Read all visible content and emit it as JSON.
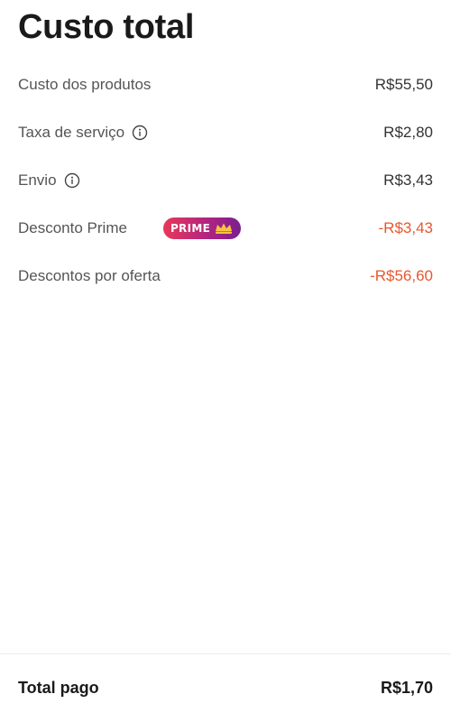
{
  "header": {
    "title": "Custo total"
  },
  "rows": [
    {
      "label": "Custo dos produtos",
      "value": "R$55,50"
    },
    {
      "label": "Taxa de serviço",
      "value": "R$2,80"
    },
    {
      "label": "Envio",
      "value": "R$3,43"
    },
    {
      "label": "Desconto Prime",
      "badge": "PRIME",
      "value": "-R$3,43"
    },
    {
      "label": "Descontos por oferta",
      "value": "-R$56,60"
    }
  ],
  "footer": {
    "label": "Total pago",
    "value": "R$1,70"
  },
  "colors": {
    "discount": "#e8572f",
    "prime_gradient_start": "#e8385a",
    "prime_gradient_end": "#7a1f8e",
    "crown": "#f6c343"
  },
  "icons": {
    "service_fee_info": "info-icon",
    "shipping_info": "info-icon",
    "prime_crown": "crown-icon"
  }
}
